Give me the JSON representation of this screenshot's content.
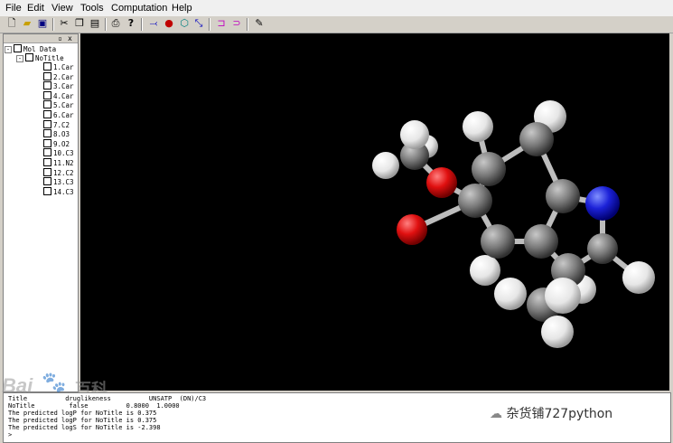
{
  "menu": [
    "File",
    "Edit",
    "View",
    "Tools",
    "Computation",
    "Help"
  ],
  "toolbar_icons": [
    "new-file-icon",
    "open-folder-icon",
    "save-icon",
    "cut-icon",
    "copy-icon",
    "paste-icon",
    "print-icon",
    "help-icon",
    "bond-tool-icon",
    "atom-tool-icon",
    "ring-tool-icon",
    "rotate-tool-icon",
    "fragment-icon",
    "query-icon",
    "pencil-icon"
  ],
  "tree": {
    "root": "Mol Data",
    "molecule": "NoTitle",
    "atoms": [
      "1.Car",
      "2.Car",
      "3.Car",
      "4.Car",
      "5.Car",
      "6.Car",
      "7.C2",
      "8.O3",
      "9.O2",
      "10.C3",
      "11.N2",
      "12.C2",
      "13.C3",
      "14.C3"
    ]
  },
  "output": {
    "lines": [
      "Title          druglikeness          UNSATP  (DN)/C3",
      "NoTitle         false          0.8000  1.0000",
      "The predicted logP for NoTitle is 0.375",
      "The predicted logP for NoTitle is 0.375",
      "The predicted logS for NoTitle is -2.398",
      ">"
    ]
  },
  "watermark": {
    "baidu": "Bai",
    "baike": "百科"
  },
  "wechat_handle": "杂货铺727python",
  "colors": {
    "carbon": "#808080",
    "hydrogen": "#f2f2f2",
    "oxygen": "#e01010",
    "nitrogen": "#1c22d8",
    "viewport_bg": "#000000"
  }
}
